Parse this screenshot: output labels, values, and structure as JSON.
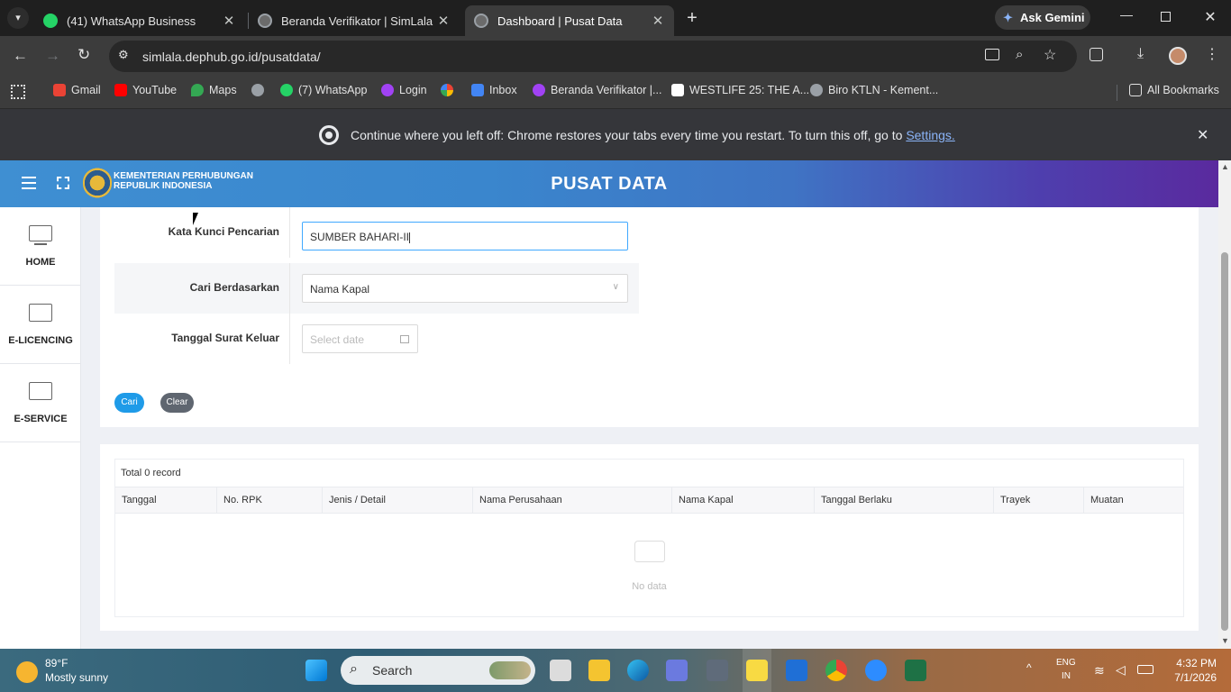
{
  "browser": {
    "tabs": [
      {
        "title": "(41) WhatsApp Business",
        "favicon_badge": "41",
        "color": "#25d366"
      },
      {
        "title": "Beranda Verifikator | SimLala",
        "color": "#9aa0a6"
      },
      {
        "title": "Dashboard | Pusat Data",
        "color": "#9aa0a6",
        "active": true
      }
    ],
    "gemini_label": "Ask Gemini",
    "url": "simlala.dephub.go.id/pusatdata/",
    "bookmarks": [
      {
        "label": "Gmail",
        "color": "#ea4335"
      },
      {
        "label": "YouTube",
        "color": "#ff0000"
      },
      {
        "label": "Maps",
        "color": "#34a853"
      },
      {
        "label": "",
        "color": "#9aa0a6"
      },
      {
        "label": "(7) WhatsApp",
        "color": "#25d366"
      },
      {
        "label": "Login",
        "color": "#a142f4"
      },
      {
        "label": "",
        "color": "#fbbc04"
      },
      {
        "label": "Inbox",
        "color": "#4285f4"
      },
      {
        "label": "Beranda Verifikator |...",
        "color": "#a142f4"
      },
      {
        "label": "WESTLIFE 25: THE A...",
        "color": "#ffffff"
      },
      {
        "label": "Biro KTLN - Kement...",
        "color": "#9aa0a6"
      }
    ],
    "all_bookmarks": "All Bookmarks",
    "infobar": {
      "text": "Continue where you left off: Chrome restores your tabs every time you restart. To turn this off, go to ",
      "link": "Settings."
    }
  },
  "site": {
    "logo_line1": "KEMENTERIAN PERHUBUNGAN",
    "logo_line2": "REPUBLIK INDONESIA",
    "title": "PUSAT DATA",
    "nav": [
      {
        "label": "HOME"
      },
      {
        "label": "E-LICENCING"
      },
      {
        "label": "E-SERVICE"
      }
    ]
  },
  "form": {
    "keyword_label": "Kata Kunci Pencarian",
    "keyword_value": "SUMBER BAHARI-II",
    "searchby_label": "Cari Berdasarkan",
    "searchby_value": "Nama Kapal",
    "date_label": "Tanggal Surat Keluar",
    "date_placeholder": "Select date",
    "search_button": "Cari",
    "clear_button": "Clear"
  },
  "results": {
    "total": "Total 0 record",
    "columns": [
      "Tanggal",
      "No. RPK",
      "Jenis / Detail",
      "Nama Perusahaan",
      "Nama Kapal",
      "Tanggal Berlaku",
      "Trayek",
      "Muatan"
    ],
    "empty": "No data"
  },
  "taskbar": {
    "temp": "89°F",
    "weather": "Mostly sunny",
    "search_placeholder": "Search",
    "lang": "ENG",
    "lang_region": "IN",
    "time": "4:32 PM",
    "date": "7/1/2026"
  }
}
